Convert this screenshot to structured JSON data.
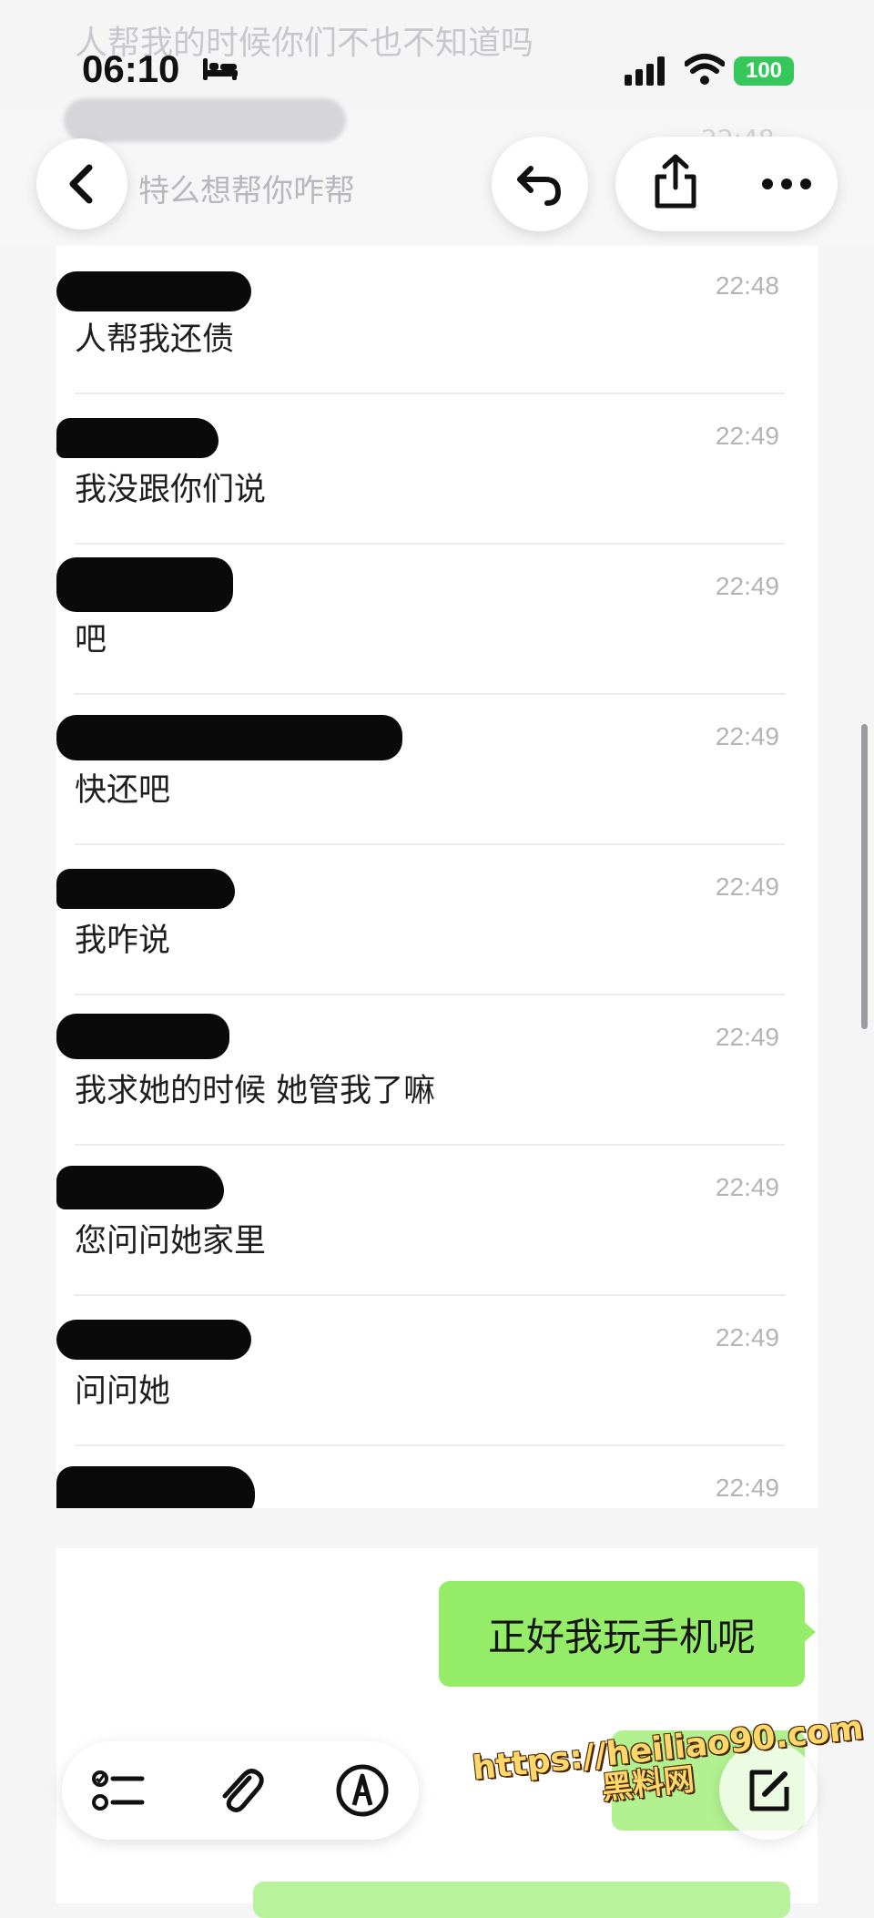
{
  "status_bar": {
    "faded_top_text": "人帮我的时候你们不也不知道吗",
    "time": "06:10",
    "battery": "100"
  },
  "header": {
    "faded_preview": "特么想帮你咋帮",
    "faded_time": "22:48"
  },
  "messages": [
    {
      "time": "22:48",
      "text": "人帮我还债"
    },
    {
      "time": "22:49",
      "text": "我没跟你们说"
    },
    {
      "time": "22:49",
      "text": "吧"
    },
    {
      "time": "22:49",
      "text": "快还吧"
    },
    {
      "time": "22:49",
      "text": "我咋说"
    },
    {
      "time": "22:49",
      "text": "我求她的时候 她管我了嘛"
    },
    {
      "time": "22:49",
      "text": "您问问她家里"
    },
    {
      "time": "22:49",
      "text": "问问她"
    },
    {
      "time": "22:49",
      "text": ""
    }
  ],
  "chat": {
    "sent_bubble": "正好我玩手机呢"
  },
  "watermark": {
    "url": "https://heiliao90.com",
    "caption": "黑料网"
  },
  "colors": {
    "bubble_green": "#95ec69",
    "battery_green": "#35c759",
    "redaction": "#0a0a0a"
  },
  "icons": [
    "back-arrow-icon",
    "reply-icon",
    "share-icon",
    "more-icon",
    "checklist-icon",
    "paperclip-icon",
    "markup-pen-icon",
    "compose-icon"
  ]
}
